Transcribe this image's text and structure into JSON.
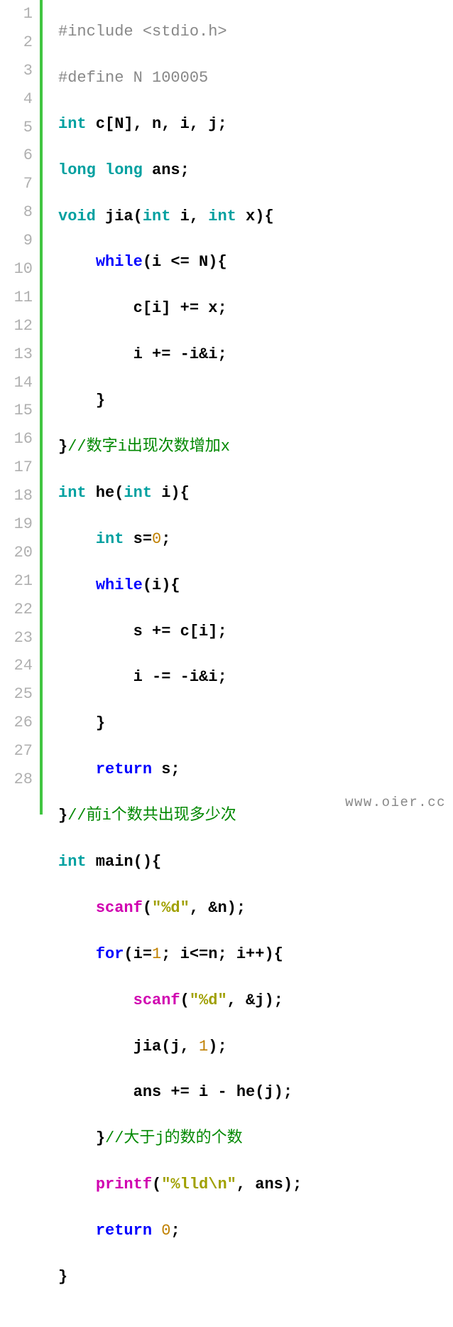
{
  "line_count": 28,
  "watermark": "www.oier.cc",
  "code": {
    "l1": {
      "preproc": "#include <stdio.h>"
    },
    "l2": {
      "preproc": "#define N 100005"
    },
    "l3": {
      "type": "int",
      "rest": " c[N], n, i, j;"
    },
    "l4": {
      "type": "long long",
      "rest": " ans;"
    },
    "l5": {
      "kw": "void",
      "ident1": " jia(",
      "type1": "int",
      "ident2": " i, ",
      "type2": "int",
      "ident3": " x){"
    },
    "l6": {
      "indent": "    ",
      "kw": "while",
      "rest": "(i <= N){"
    },
    "l7": {
      "indent": "        ",
      "rest": "c[i] += x;"
    },
    "l8": {
      "indent": "        ",
      "rest": "i += -i&i;"
    },
    "l9": {
      "indent": "    ",
      "rest": "}"
    },
    "l10": {
      "rest": "}",
      "comment": "//数字i出现次数增加x"
    },
    "l11": {
      "type": "int",
      "ident": " he(",
      "type2": "int",
      "rest": " i){"
    },
    "l12": {
      "indent": "    ",
      "type": "int",
      "rest": " s=",
      "num": "0",
      "semi": ";"
    },
    "l13": {
      "indent": "    ",
      "kw": "while",
      "rest": "(i){"
    },
    "l14": {
      "indent": "        ",
      "rest": "s += c[i];"
    },
    "l15": {
      "indent": "        ",
      "rest": "i -= -i&i;"
    },
    "l16": {
      "indent": "    ",
      "rest": "}"
    },
    "l17": {
      "indent": "    ",
      "kw": "return",
      "rest": " s;"
    },
    "l18": {
      "rest": "}",
      "comment": "//前i个数共出现多少次"
    },
    "l19": {
      "type": "int",
      "rest": " main(){"
    },
    "l20": {
      "indent": "    ",
      "func": "scanf",
      "paren": "(",
      "str": "\"%d\"",
      "rest": ", &n);"
    },
    "l21": {
      "indent": "    ",
      "kw": "for",
      "rest1": "(i=",
      "num": "1",
      "rest2": "; i<=n; i++){"
    },
    "l22": {
      "indent": "        ",
      "func": "scanf",
      "paren": "(",
      "str": "\"%d\"",
      "rest": ", &j);"
    },
    "l23": {
      "indent": "        ",
      "rest1": "jia(j, ",
      "num": "1",
      "rest2": ");"
    },
    "l24": {
      "indent": "        ",
      "rest": "ans += i - he(j);"
    },
    "l25": {
      "indent": "    ",
      "rest": "}",
      "comment": "//大于j的数的个数"
    },
    "l26": {
      "indent": "    ",
      "func": "printf",
      "paren": "(",
      "str": "\"%lld\\n\"",
      "rest": ", ans);"
    },
    "l27": {
      "indent": "    ",
      "kw": "return",
      "rest": " ",
      "num": "0",
      "semi": ";"
    },
    "l28": {
      "rest": "}"
    }
  }
}
